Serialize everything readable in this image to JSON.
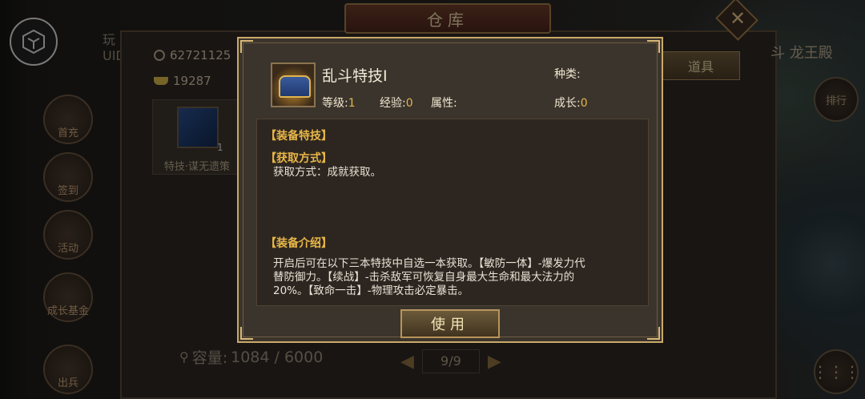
{
  "background": {
    "player_name": "玩",
    "player_uid": "UID",
    "side_text": "斗 龙王殿",
    "nav_left": [
      "首充",
      "签到",
      "活动",
      "成长基金",
      "出兵"
    ],
    "nav_right": [
      "排行"
    ]
  },
  "storage": {
    "title": "仓库",
    "coins": "62721125",
    "ingots": "19287",
    "tab_tools": "道具",
    "item": {
      "name": "特技·谋无遗策",
      "count": "1"
    },
    "capacity_label": "容量:",
    "capacity_value": "1084 / 6000",
    "page": "9/9"
  },
  "modal": {
    "title": "乱斗特技Ⅰ",
    "level_label": "等级:",
    "level_value": "1",
    "exp_label": "经验:",
    "exp_value": "0",
    "attr_label": "属性:",
    "kind_label": "种类:",
    "growth_label": "成长:",
    "growth_value": "0",
    "section_skill": "【装备特技】",
    "section_source": "【获取方式】",
    "source_text": "获取方式：成就获取。",
    "section_intro": "【装备介绍】",
    "intro_lines": [
      "开启后可在以下三本特技中自选一本获取。【敏防一体】-爆发力代",
      "替防御力。【续战】-击杀敌军可恢复自身最大生命和最大法力的",
      "20%。【致命一击】-物理攻击必定暴击。"
    ],
    "use_button": "使用"
  },
  "colors": {
    "accent": "#e2b64c",
    "border": "#c9a96a"
  }
}
